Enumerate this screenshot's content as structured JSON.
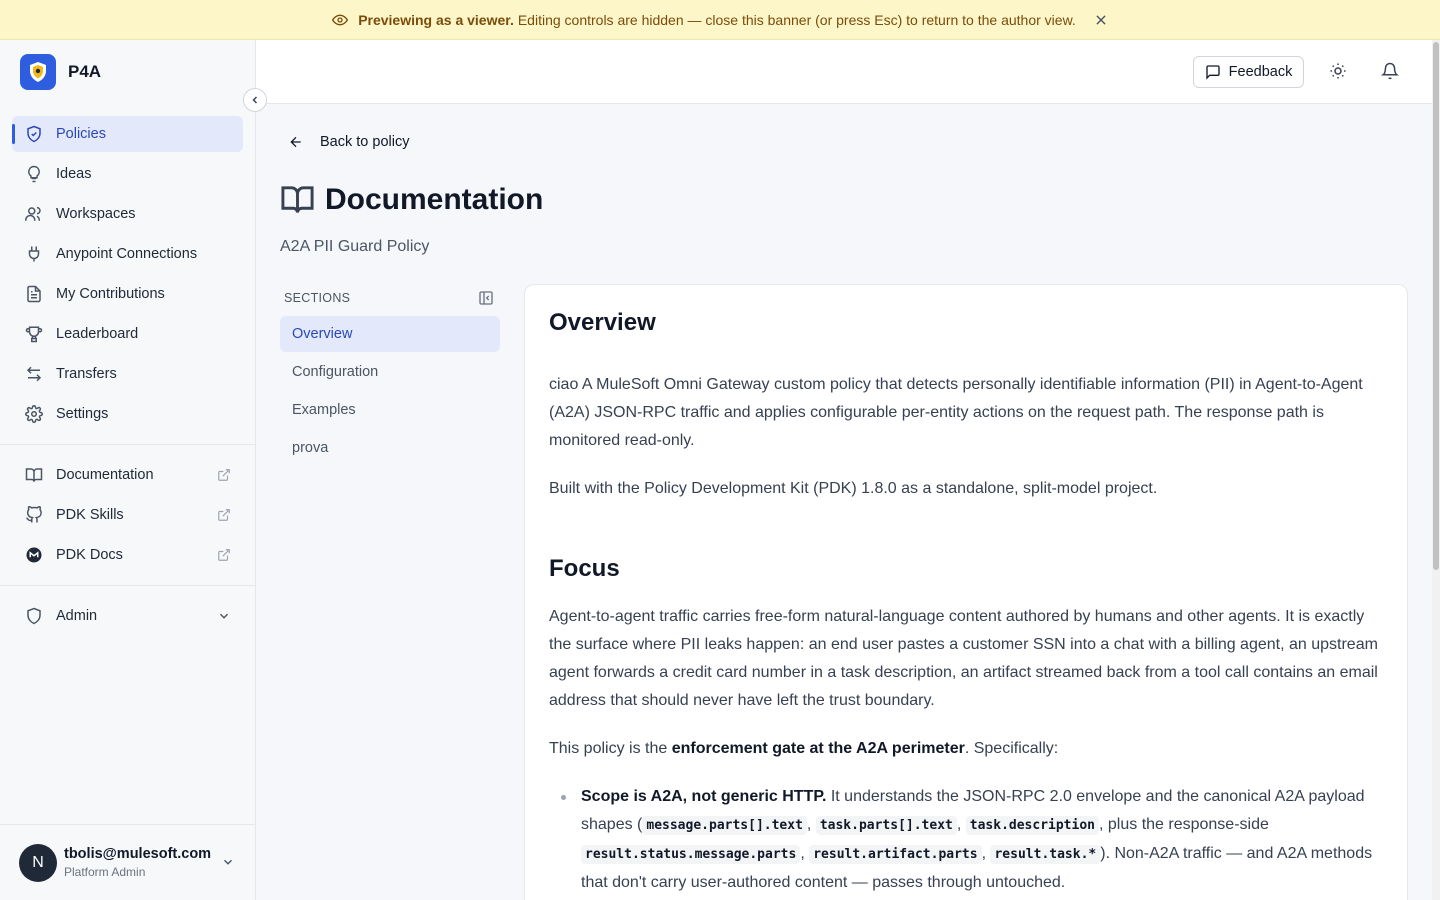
{
  "banner": {
    "bold": "Previewing as a viewer.",
    "text": "Editing controls are hidden — close this banner (or press Esc) to return to the author view."
  },
  "app": {
    "name": "P4A"
  },
  "sidebar": {
    "nav": [
      {
        "label": "Policies",
        "icon": "shield-check-icon",
        "active": true
      },
      {
        "label": "Ideas",
        "icon": "lightbulb-icon"
      },
      {
        "label": "Workspaces",
        "icon": "users-icon"
      },
      {
        "label": "Anypoint Connections",
        "icon": "plug-icon"
      },
      {
        "label": "My Contributions",
        "icon": "file-text-icon"
      },
      {
        "label": "Leaderboard",
        "icon": "trophy-icon"
      },
      {
        "label": "Transfers",
        "icon": "arrows-left-right-icon"
      },
      {
        "label": "Settings",
        "icon": "gear-icon"
      }
    ],
    "links": [
      {
        "label": "Documentation",
        "icon": "book-icon"
      },
      {
        "label": "PDK Skills",
        "icon": "github-icon"
      },
      {
        "label": "PDK Docs",
        "icon": "mulesoft-icon"
      }
    ],
    "admin": {
      "label": "Admin"
    },
    "user": {
      "initial": "N",
      "email": "tbolis@mulesoft.com",
      "role": "Platform Admin"
    }
  },
  "header": {
    "feedback_label": "Feedback"
  },
  "page": {
    "back_label": "Back to policy",
    "title": "Documentation",
    "subtitle": "A2A PII Guard Policy"
  },
  "sections": {
    "heading": "SECTIONS",
    "items": [
      {
        "label": "Overview",
        "active": true
      },
      {
        "label": "Configuration"
      },
      {
        "label": "Examples"
      },
      {
        "label": "prova"
      }
    ]
  },
  "doc": {
    "overview_heading": "Overview",
    "overview_p1": "ciao A MuleSoft Omni Gateway custom policy that detects personally identifiable information (PII) in Agent-to-Agent (A2A) JSON-RPC traffic and applies configurable per-entity actions on the request path. The response path is monitored read-only.",
    "overview_p2": "Built with the Policy Development Kit (PDK) 1.8.0 as a standalone, split-model project.",
    "focus_heading": "Focus",
    "focus_p1": "Agent-to-agent traffic carries free-form natural-language content authored by humans and other agents. It is exactly the surface where PII leaks happen: an end user pastes a customer SSN into a chat with a billing agent, an upstream agent forwards a credit card number in a task description, an artifact streamed back from a tool call contains an email address that should never have left the trust boundary.",
    "focus_p2_pre": "This policy is the ",
    "focus_p2_bold": "enforcement gate at the A2A perimeter",
    "focus_p2_post": ". Specifically:",
    "bullet1_bold": "Scope is A2A, not generic HTTP.",
    "bullet1_t1": " It understands the JSON-RPC 2.0 envelope and the canonical A2A payload shapes (",
    "code1": "message.parts[].text",
    "sep1": ", ",
    "code2": "task.parts[].text",
    "sep2": ", ",
    "code3": "task.description",
    "bullet1_t2": ", plus the response-side ",
    "code4": "result.status.message.parts",
    "sep3": ", ",
    "code5": "result.artifact.parts",
    "sep4": ", ",
    "code6": "result.task.*",
    "bullet1_t3": "). Non-A2A traffic — and A2A methods that don't carry user-authored content — passes through untouched."
  }
}
